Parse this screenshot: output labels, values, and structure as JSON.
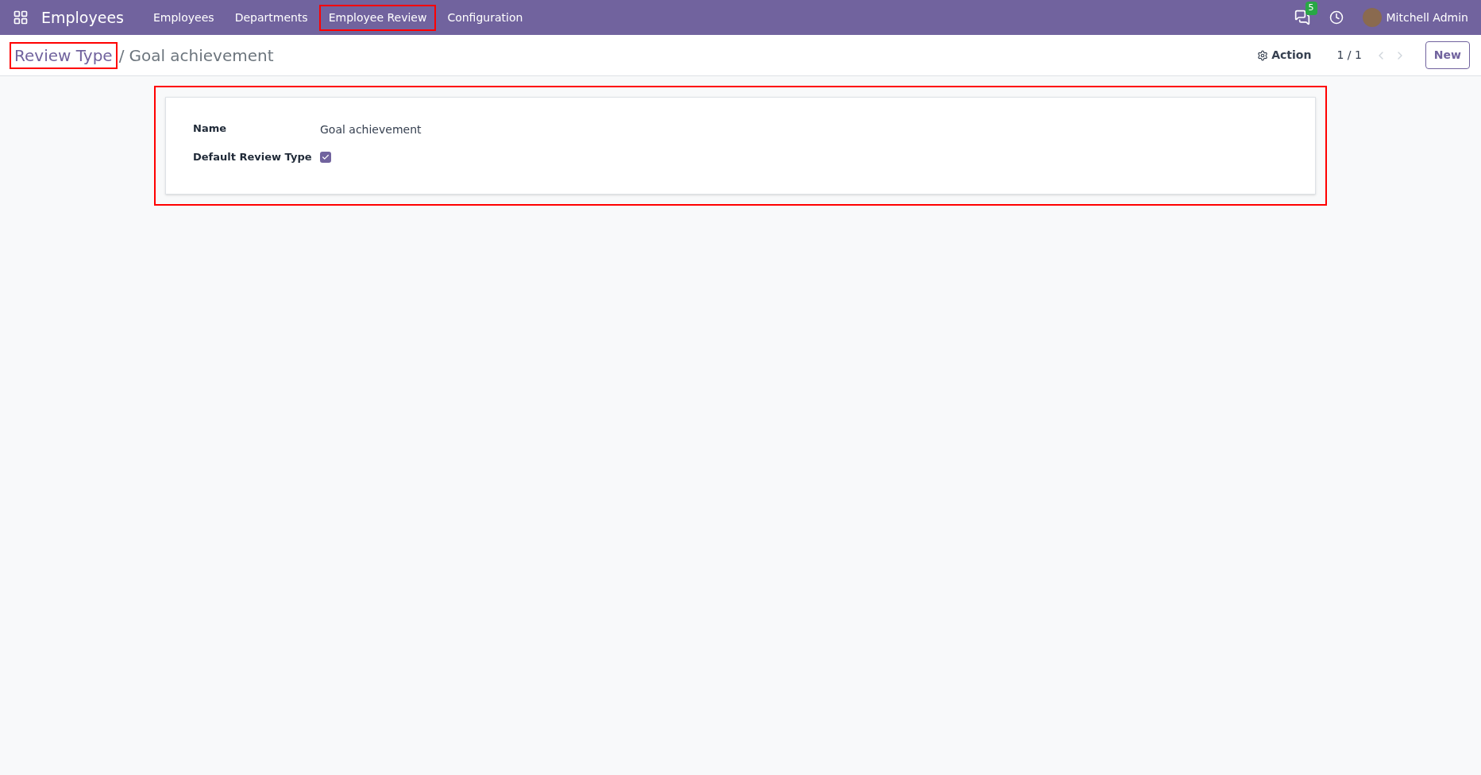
{
  "navbar": {
    "app_name": "Employees",
    "menu": [
      {
        "label": "Employees",
        "highlighted": false
      },
      {
        "label": "Departments",
        "highlighted": false
      },
      {
        "label": "Employee Review",
        "highlighted": true
      },
      {
        "label": "Configuration",
        "highlighted": false
      }
    ],
    "messages_badge": "5",
    "user_name": "Mitchell Admin"
  },
  "control_panel": {
    "breadcrumb": [
      {
        "label": "Review Type",
        "highlighted": true
      }
    ],
    "separator": "/",
    "current": "Goal achievement",
    "action": "Action",
    "pager": "1 / 1",
    "new_button": "New"
  },
  "form": {
    "highlighted": true,
    "fields": [
      {
        "kind": "text",
        "label": "Name",
        "value": "Goal achievement"
      },
      {
        "kind": "checkbox",
        "label": "Default Review Type",
        "checked": true
      }
    ]
  }
}
